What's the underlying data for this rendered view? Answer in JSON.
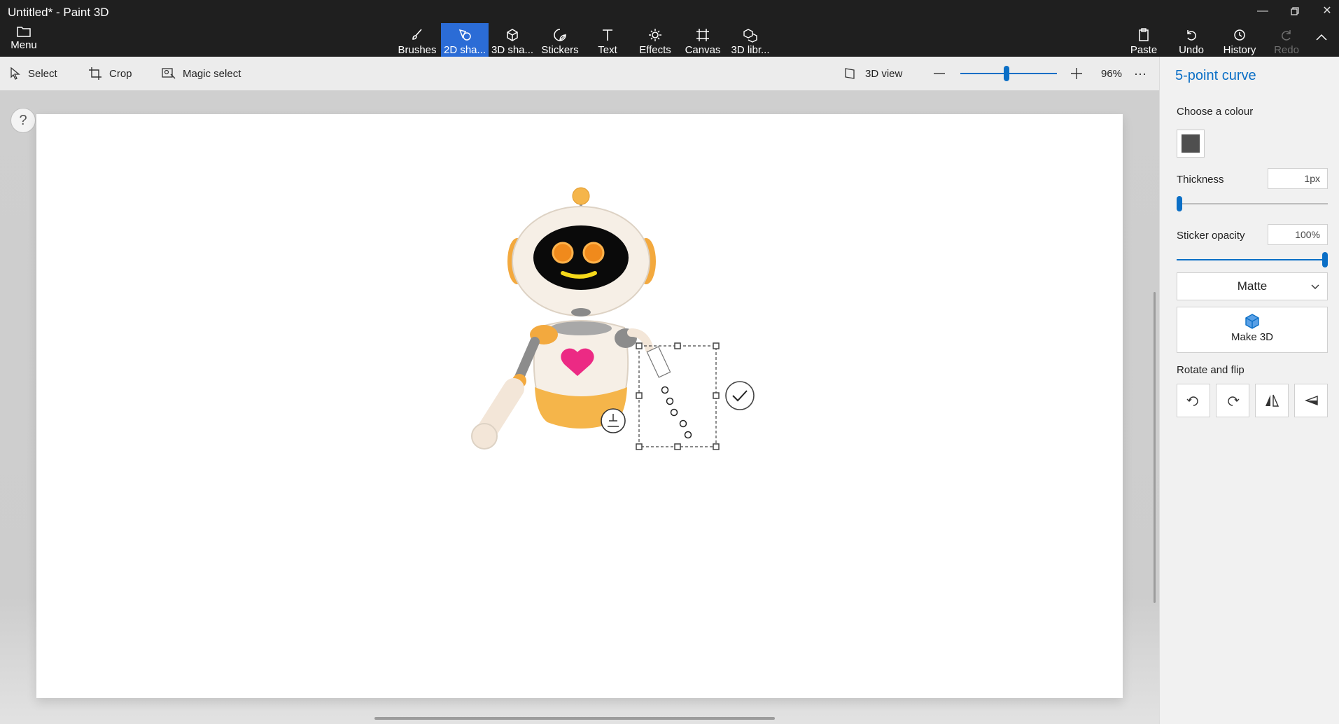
{
  "window": {
    "title": "Untitled* - Paint 3D",
    "controls": [
      "minimize-icon",
      "restore-icon",
      "close-icon"
    ]
  },
  "toolbar": {
    "menu_label": "Menu",
    "tools": [
      {
        "label": "Brushes",
        "icon": "brush-icon"
      },
      {
        "label": "2D sha...",
        "icon": "2d-shapes-icon",
        "active": true
      },
      {
        "label": "3D sha...",
        "icon": "3d-shapes-icon"
      },
      {
        "label": "Stickers",
        "icon": "sticker-icon"
      },
      {
        "label": "Text",
        "icon": "text-icon"
      },
      {
        "label": "Effects",
        "icon": "sun-icon"
      },
      {
        "label": "Canvas",
        "icon": "canvas-icon"
      },
      {
        "label": "3D libr...",
        "icon": "3d-library-icon"
      }
    ],
    "actions": [
      {
        "label": "Paste",
        "icon": "clipboard-icon",
        "enabled": true
      },
      {
        "label": "Undo",
        "icon": "undo-icon",
        "enabled": true
      },
      {
        "label": "History",
        "icon": "history-icon",
        "enabled": true
      },
      {
        "label": "Redo",
        "icon": "redo-icon",
        "enabled": false
      }
    ]
  },
  "subtoolbar": {
    "select_label": "Select",
    "crop_label": "Crop",
    "magic_select_label": "Magic select",
    "view_3d_label": "3D view",
    "zoom_percent": "96%",
    "zoom_fraction": 0.48,
    "more_label": "···"
  },
  "canvas": {
    "help_label": "?",
    "sticker": "robot-sticker"
  },
  "panel": {
    "title": "5-point curve",
    "colour_label": "Choose a colour",
    "colour_value": "#4f4f4f",
    "thickness_label": "Thickness",
    "thickness_value": "1px",
    "thickness_fraction": 0.0,
    "opacity_label": "Sticker opacity",
    "opacity_value": "100%",
    "opacity_fraction": 1.0,
    "material_value": "Matte",
    "make3d_label": "Make 3D",
    "rotate_label": "Rotate and flip",
    "rotate_buttons": [
      "rotate-left-icon",
      "rotate-right-icon",
      "flip-horizontal-icon",
      "flip-vertical-icon"
    ]
  },
  "colors": {
    "accent": "#0b6fc6",
    "active_tool": "#2b6cd6",
    "titlebar": "#1f1f1f"
  }
}
